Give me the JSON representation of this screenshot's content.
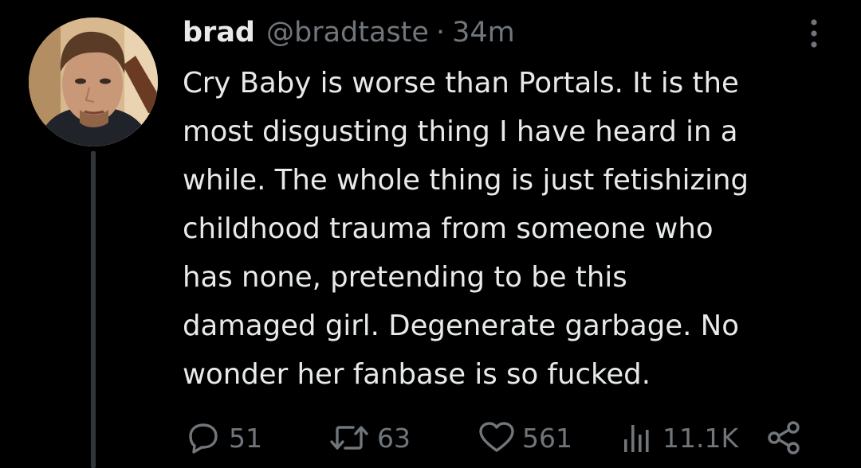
{
  "tweet": {
    "author_name": "brad",
    "handle": "@bradtaste",
    "separator": "·",
    "time": "34m",
    "lines": [
      "Cry Baby is worse than Portals. It is the",
      "most disgusting thing I have heard in a",
      "while. The whole thing is just fetishizing",
      "childhood trauma from someone who",
      "has none, pretending to be this",
      "damaged girl. Degenerate garbage. No",
      "wonder her fanbase is so fucked."
    ],
    "stats": {
      "replies": "51",
      "retweets": "63",
      "likes": "561",
      "views": "11.1K"
    }
  },
  "icons": {
    "more": "more-vertical-icon",
    "reply": "reply-icon",
    "retweet": "retweet-icon",
    "like": "heart-icon",
    "views": "views-icon",
    "share": "share-icon"
  },
  "colors": {
    "background": "#000000",
    "primary_text": "#e7e9ea",
    "secondary_text": "#71767b",
    "thread_line": "#333639"
  }
}
